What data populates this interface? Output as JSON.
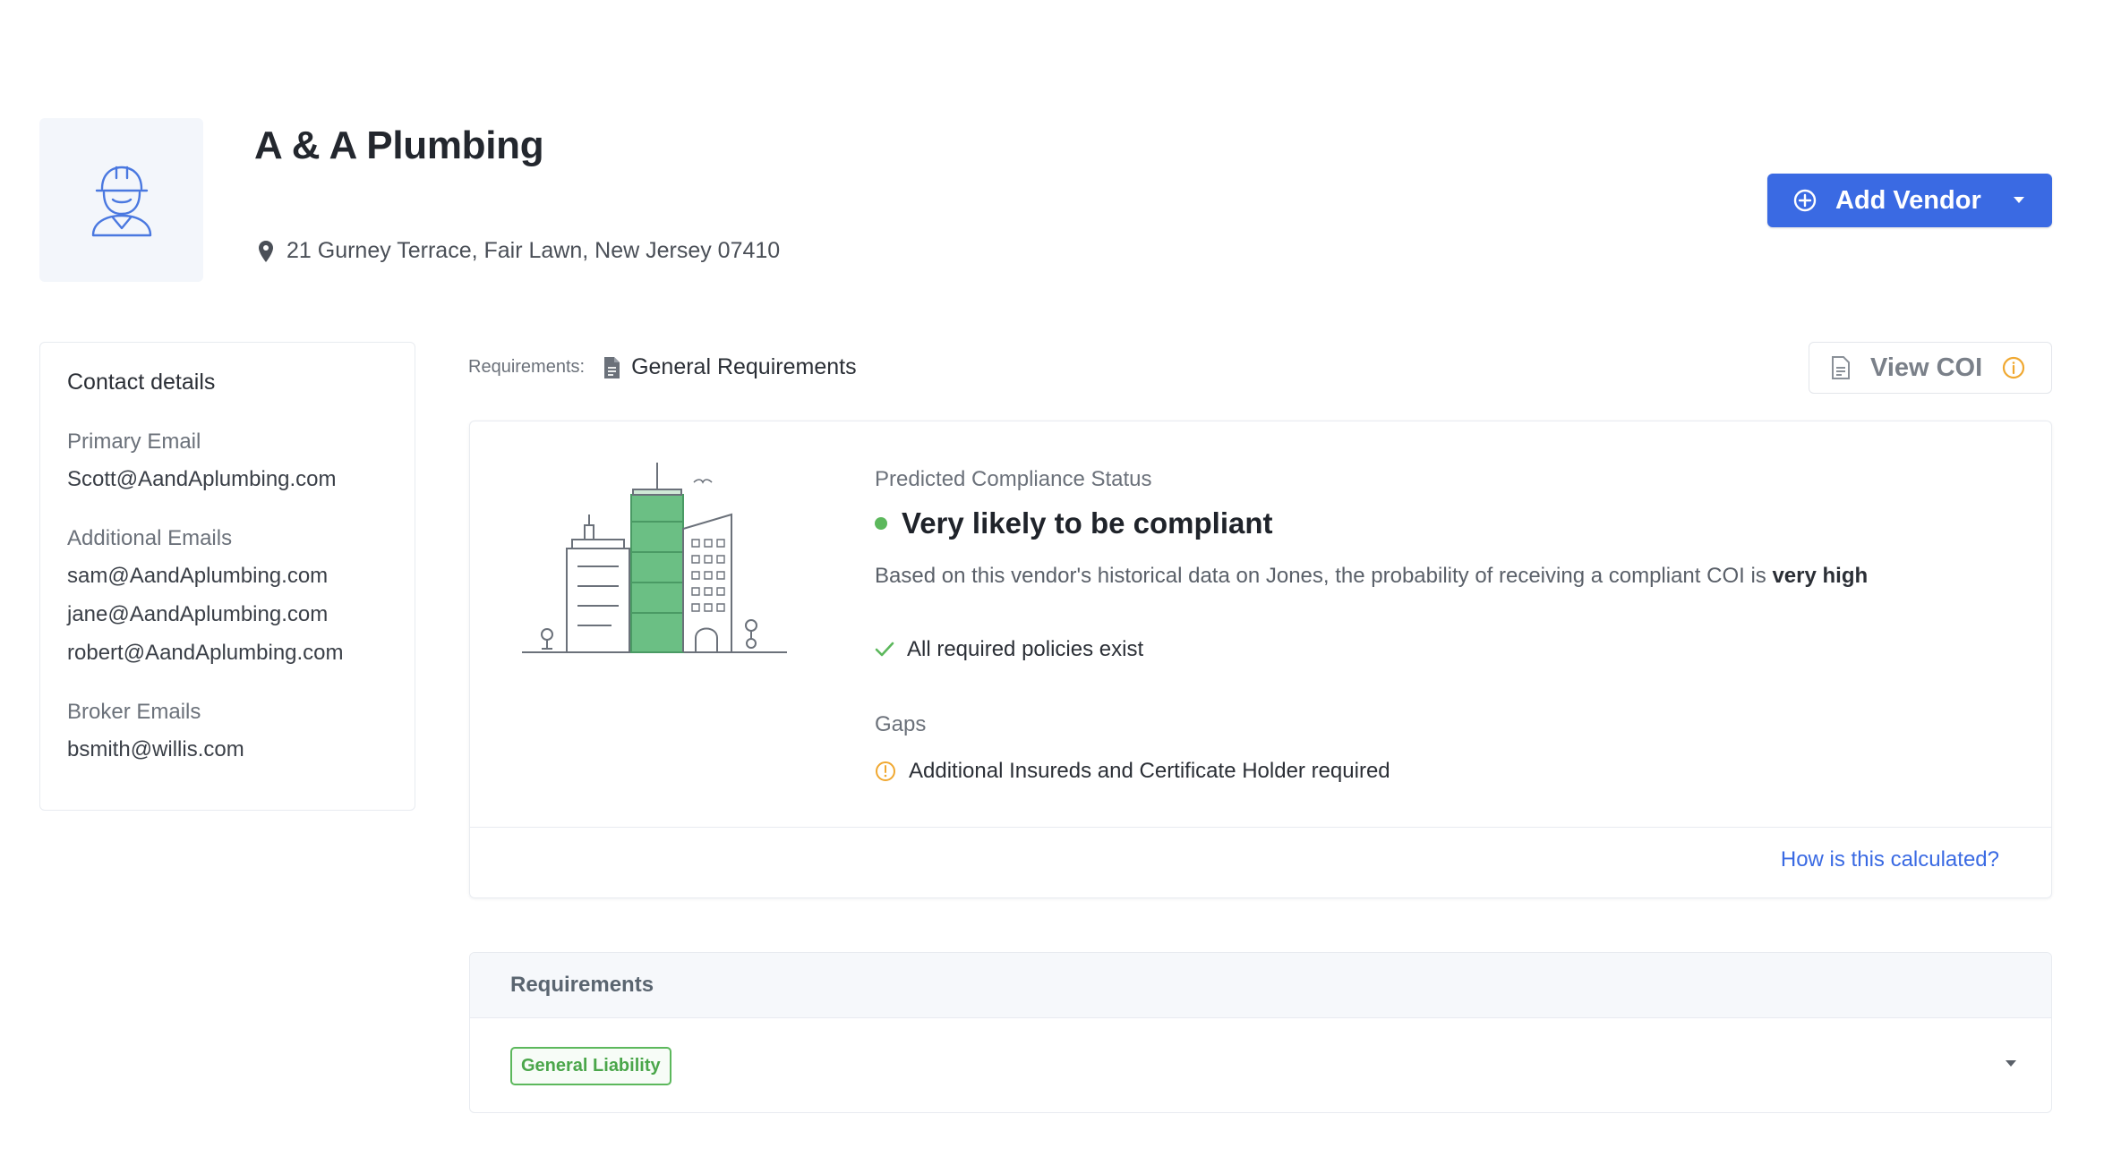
{
  "vendor": {
    "name": "A & A Plumbing",
    "address": "21 Gurney Terrace, Fair Lawn, New Jersey 07410"
  },
  "header": {
    "add_vendor_label": "Add Vendor"
  },
  "contact": {
    "heading": "Contact details",
    "primary_label": "Primary Email",
    "primary_email": "Scott@AandAplumbing.com",
    "additional_label": "Additional Emails",
    "additional_emails": [
      "sam@AandAplumbing.com",
      "jane@AandAplumbing.com",
      "robert@AandAplumbing.com"
    ],
    "broker_label": "Broker Emails",
    "broker_email": "bsmith@willis.com"
  },
  "requirements_line": {
    "label": "Requirements:",
    "name": "General Requirements"
  },
  "view_coi_label": "View COI",
  "compliance": {
    "predicted_label": "Predicted Compliance Status",
    "status": "Very likely to be compliant",
    "status_color": "#5cb85c",
    "description_prefix": "Based on this vendor's historical data on Jones, the probability of receiving a compliant COI is ",
    "description_emphasis": "very high",
    "policy_check": "All required policies exist",
    "gaps_label": "Gaps",
    "gap_item": "Additional Insureds and Certificate Holder required",
    "how_calculated": "How is this calculated?"
  },
  "requirements_table": {
    "header": "Requirements",
    "tag": "General Liability"
  },
  "colors": {
    "accent": "#3a6ae3",
    "success": "#5cb85c",
    "warning": "#f0a830"
  }
}
